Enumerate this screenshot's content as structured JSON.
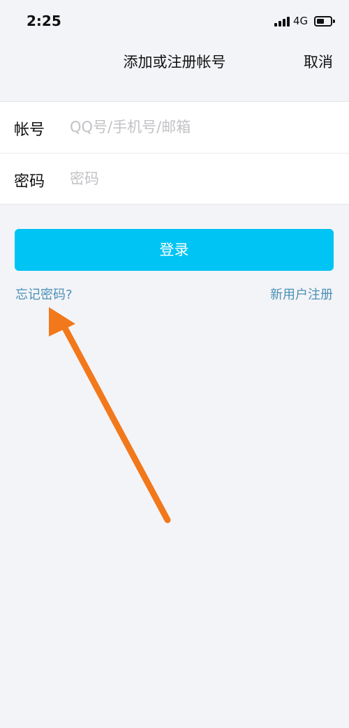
{
  "status_bar": {
    "time": "2:25",
    "network": "4G",
    "signal_icon": "signal-bars-icon",
    "battery_icon": "battery-icon"
  },
  "nav": {
    "title": "添加或注册帐号",
    "cancel_label": "取消"
  },
  "form": {
    "account_label": "帐号",
    "account_placeholder": "QQ号/手机号/邮箱",
    "account_value": "",
    "password_label": "密码",
    "password_placeholder": "密码",
    "password_value": ""
  },
  "actions": {
    "login_label": "登录",
    "forgot_label": "忘记密码?",
    "register_label": "新用户注册"
  },
  "colors": {
    "background": "#f3f4f8",
    "login_button": "#00c4f4",
    "link": "#4a90b4",
    "annotation_arrow": "#f2781c"
  }
}
